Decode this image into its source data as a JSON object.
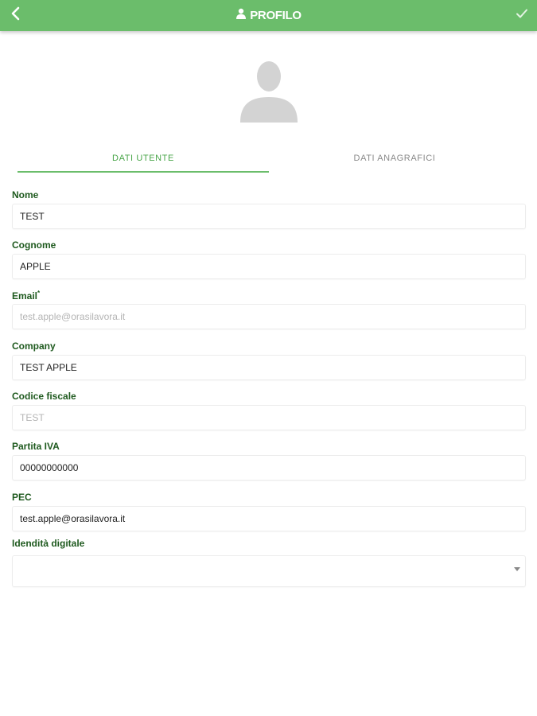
{
  "header": {
    "title": "PROFILO",
    "back_icon": "chevron-left-icon",
    "confirm_icon": "check-icon",
    "title_icon": "user-icon",
    "background_color": "#6bbd6b"
  },
  "avatar": {
    "icon": "user-silhouette-icon"
  },
  "tabs": [
    {
      "label": "DATI UTENTE",
      "active": true
    },
    {
      "label": "DATI ANAGRAFICI",
      "active": false
    }
  ],
  "form": {
    "nome": {
      "label": "Nome",
      "value": "TEST"
    },
    "cognome": {
      "label": "Cognome",
      "value": "APPLE"
    },
    "email": {
      "label": "Email",
      "required_mark": "*",
      "value": "test.apple@orasilavora.it"
    },
    "company": {
      "label": "Company",
      "value": "TEST APPLE"
    },
    "codice_fiscale": {
      "label": "Codice fiscale",
      "value": "TEST"
    },
    "partita_iva": {
      "label": "Partita IVA",
      "value": "00000000000"
    },
    "pec": {
      "label": "PEC",
      "value": "test.apple@orasilavora.it"
    },
    "identita_digitale": {
      "label": "Idendità digitale",
      "value": ""
    }
  }
}
